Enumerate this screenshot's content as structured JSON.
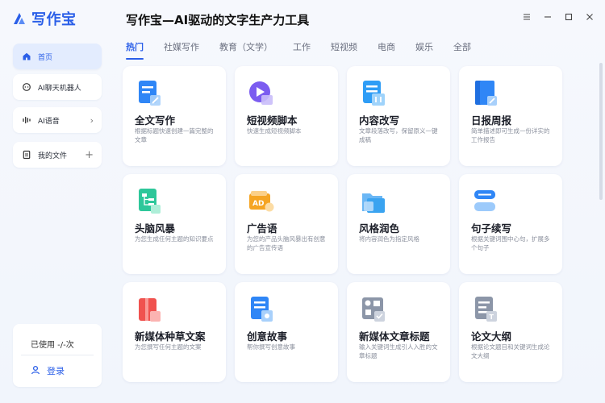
{
  "app": {
    "logo_text": "写作宝",
    "title": "写作宝—AI驱动的文字生产力工具"
  },
  "sidebar": {
    "items": [
      {
        "label": "首页",
        "icon": "home-icon",
        "active": true
      },
      {
        "label": "AI聊天机器人",
        "icon": "chat-icon"
      },
      {
        "label": "AI语音",
        "icon": "voice-wave-icon",
        "trailing": "›"
      },
      {
        "label": "我的文件",
        "icon": "file-icon",
        "trailing": "+"
      }
    ],
    "usage": "已使用 -/-次",
    "login": "登录"
  },
  "window_controls": [
    "menu-icon",
    "minimize-icon",
    "maximize-icon",
    "close-icon"
  ],
  "tabs": [
    "热门",
    "社媒写作",
    "教育（文学）",
    "工作",
    "短视频",
    "电商",
    "娱乐",
    "全部"
  ],
  "cards": [
    {
      "title": "全文写作",
      "desc": "根据标题快速创建一篇完整的文章",
      "icon": "document-pen-icon",
      "color": "#2f86f6"
    },
    {
      "title": "短视频脚本",
      "desc": "快速生成短视频脚本",
      "icon": "video-play-icon",
      "color": "#7b5cf0"
    },
    {
      "title": "内容改写",
      "desc": "文章段落改写，保留原义一键成稿",
      "icon": "rewrite-icon",
      "color": "#2f9df6"
    },
    {
      "title": "日报周报",
      "desc": "简单描述即可生成一份详实的工作报告",
      "icon": "report-book-icon",
      "color": "#2f86f6"
    },
    {
      "title": "头脑风暴",
      "desc": "为您生成任何主题的知识要点",
      "icon": "mindmap-icon",
      "color": "#2ec79a"
    },
    {
      "title": "广告语",
      "desc": "为您的产品头脑风暴出有创意的广告宣传语",
      "icon": "ad-icon",
      "color": "#f5a524"
    },
    {
      "title": "风格润色",
      "desc": "将内容润色为指定风格",
      "icon": "folder-style-icon",
      "color": "#3aa3f0"
    },
    {
      "title": "句子续写",
      "desc": "根据关键词围中心句，扩展多个句子",
      "icon": "sentence-icon",
      "color": "#2f86f6"
    },
    {
      "title": "新媒体种草文案",
      "desc": "为您撰写任何主题的文案",
      "icon": "gift-book-icon",
      "color": "#f0524f"
    },
    {
      "title": "创意故事",
      "desc": "帮你撰写创意故事",
      "icon": "story-icon",
      "color": "#2f86f6"
    },
    {
      "title": "新媒体文章标题",
      "desc": "输入关键词生成引人入胜的文章标题",
      "icon": "title-shapes-icon",
      "color": "#8c96a8"
    },
    {
      "title": "论文大纲",
      "desc": "根据论文题目和关键词生成论文大纲",
      "icon": "thesis-outline-icon",
      "color": "#8c96a8"
    }
  ]
}
